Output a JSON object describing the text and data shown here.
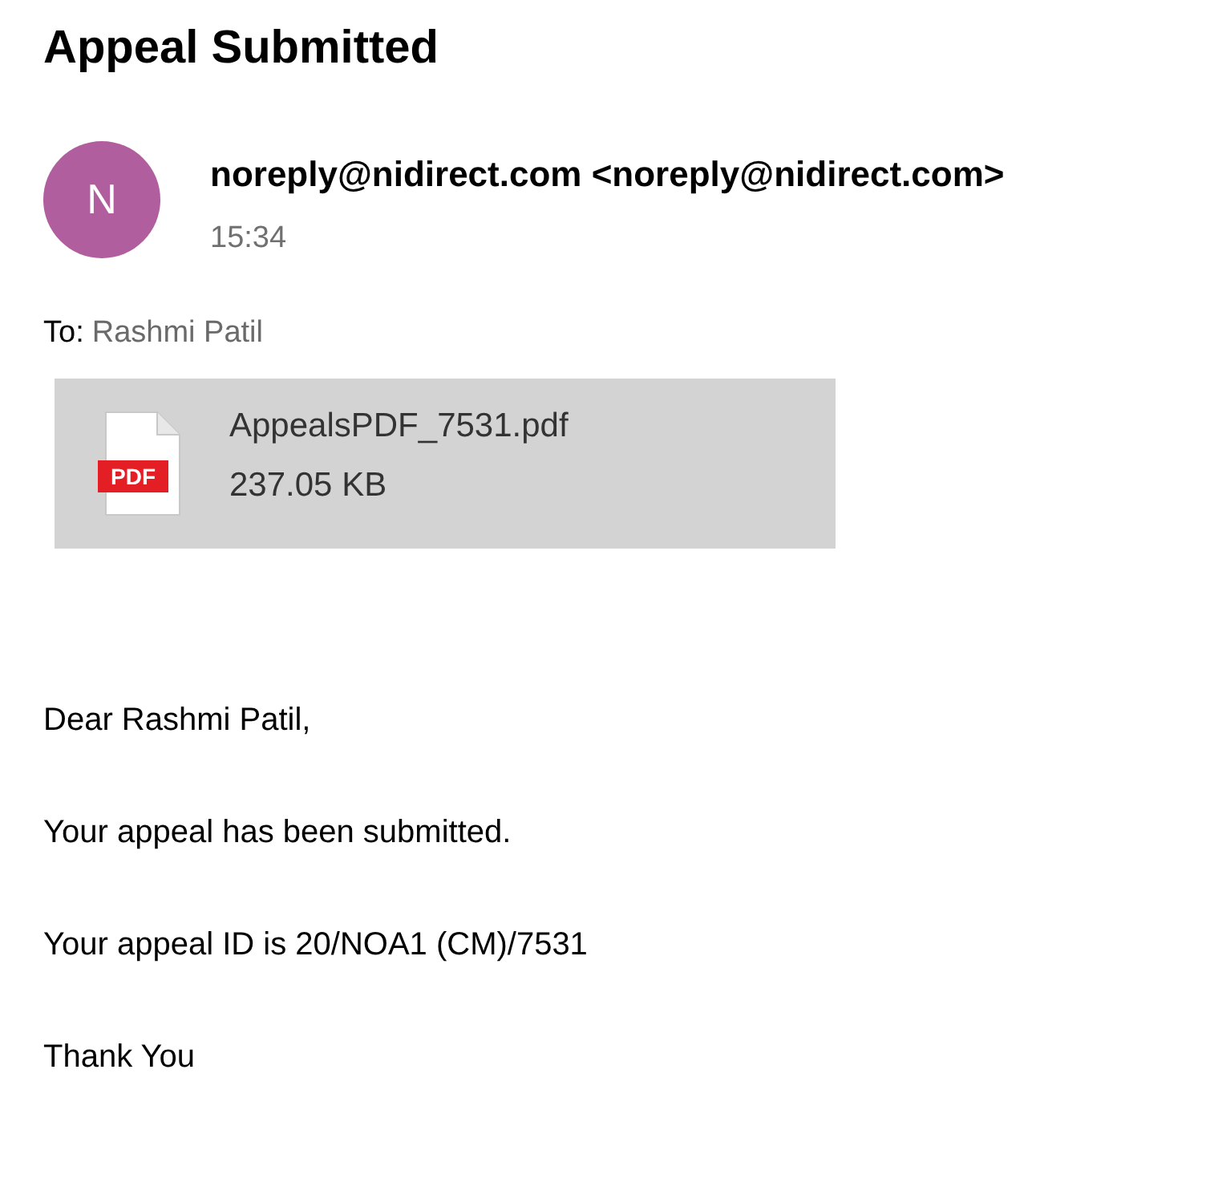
{
  "title": "Appeal Submitted",
  "sender": {
    "avatar_letter": "N",
    "name": "noreply@nidirect.com <noreply@nidirect.com>",
    "time": "15:34"
  },
  "recipient": {
    "label": "To:",
    "name": "Rashmi Patil"
  },
  "attachment": {
    "filename": "AppealsPDF_7531.pdf",
    "size": "237.05 KB",
    "badge": "PDF"
  },
  "body": [
    "Dear Rashmi Patil,",
    "Your appeal has been submitted.",
    "Your appeal ID is 20/NOA1 (CM)/7531",
    "Thank You"
  ]
}
